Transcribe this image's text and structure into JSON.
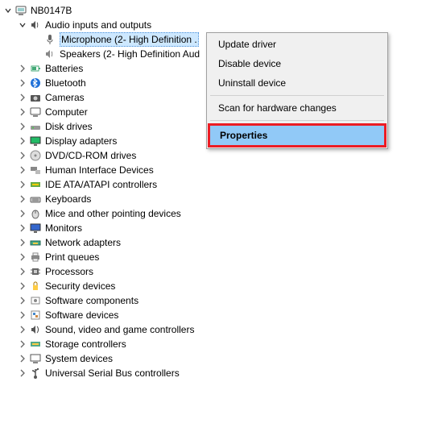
{
  "root": {
    "label": "NB0147B"
  },
  "audio": {
    "label": "Audio inputs and outputs",
    "microphone": "Microphone (2- High Definition .",
    "speakers": "Speakers (2- High Definition Aud"
  },
  "categories": {
    "batteries": "Batteries",
    "bluetooth": "Bluetooth",
    "cameras": "Cameras",
    "computer": "Computer",
    "disk_drives": "Disk drives",
    "display_adapters": "Display adapters",
    "dvd": "DVD/CD-ROM drives",
    "hid": "Human Interface Devices",
    "ide": "IDE ATA/ATAPI controllers",
    "keyboards": "Keyboards",
    "mice": "Mice and other pointing devices",
    "monitors": "Monitors",
    "network": "Network adapters",
    "print_queues": "Print queues",
    "processors": "Processors",
    "security": "Security devices",
    "software_components": "Software components",
    "software_devices": "Software devices",
    "sound": "Sound, video and game controllers",
    "storage": "Storage controllers",
    "system": "System devices",
    "usb": "Universal Serial Bus controllers"
  },
  "menu": {
    "update": "Update driver",
    "disable": "Disable device",
    "uninstall": "Uninstall device",
    "scan": "Scan for hardware changes",
    "properties": "Properties"
  }
}
